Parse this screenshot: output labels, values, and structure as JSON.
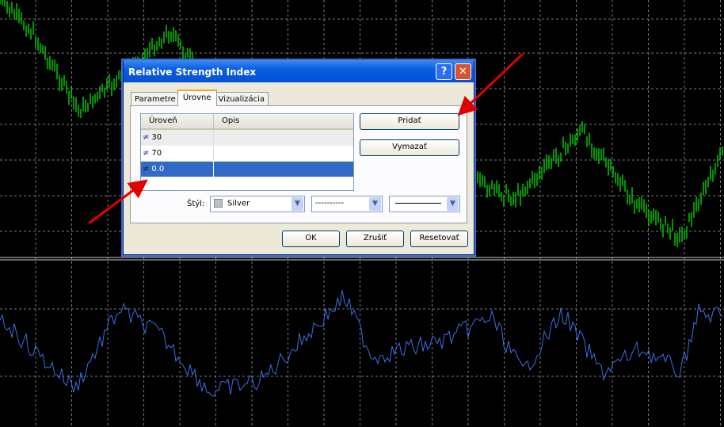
{
  "dialog": {
    "title": "Relative Strength Index",
    "help": "?",
    "close": "✕",
    "tabs": [
      "Parametre",
      "Úrovne",
      "Vizualizácia"
    ],
    "columns": [
      "Úroveň",
      "Opis"
    ],
    "levels": [
      {
        "value": "30",
        "desc": ""
      },
      {
        "value": "70",
        "desc": ""
      },
      {
        "value": "0.0",
        "desc": ""
      }
    ],
    "add": "Pridať",
    "delete": "Vymazať",
    "style_label": "Štýl:",
    "color": "Silver",
    "line_style": "----------",
    "width": "",
    "ok": "OK",
    "cancel": "Zrušiť",
    "reset": "Resetovať"
  },
  "colors": {
    "price": "#00c800",
    "rsi": "#3a6fe0",
    "grid": "#7a7a7a",
    "arrow": "#e00000"
  }
}
